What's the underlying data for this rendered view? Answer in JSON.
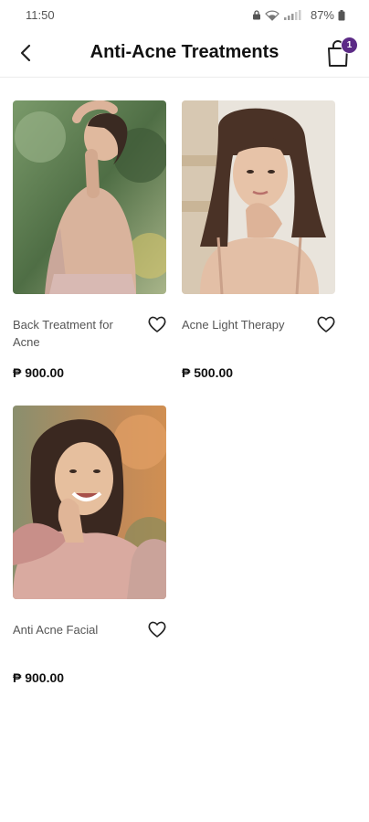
{
  "status": {
    "time": "11:50",
    "battery": "87%"
  },
  "header": {
    "title": "Anti-Acne Treatments",
    "cart_count": "1"
  },
  "products": [
    {
      "name": "Back Treatment for Acne",
      "price": "₱ 900.00"
    },
    {
      "name": "Acne Light Therapy",
      "price": "₱ 500.00"
    },
    {
      "name": "Anti Acne Facial",
      "price": "₱ 900.00"
    }
  ],
  "colors": {
    "accent": "#5b2a86",
    "text": "#111111",
    "muted": "#555555"
  }
}
